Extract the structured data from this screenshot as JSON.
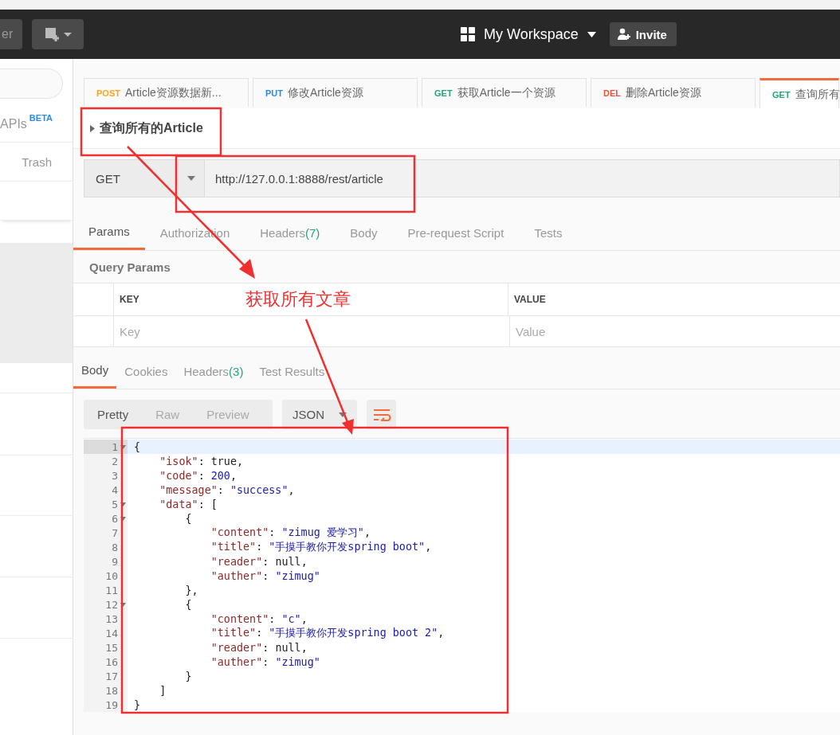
{
  "top_bar": {
    "left_button": "er",
    "workspace": "My Workspace",
    "invite_button": "Invite"
  },
  "sidebar": {
    "apis_label": "APIs",
    "apis_badge": "BETA",
    "trash_label": "Trash",
    "rows": [
      {
        "selected": false
      },
      {
        "selected": true
      },
      {
        "selected": false
      },
      {
        "selected": false
      },
      {
        "selected": false
      },
      {
        "selected": false
      },
      {
        "selected": false
      }
    ]
  },
  "tabs": [
    {
      "method": "POST",
      "color": "#f5a623",
      "label": "Article资源数据新...",
      "selected": false
    },
    {
      "method": "PUT",
      "color": "#2d8ae6",
      "label": "修改Article资源",
      "selected": false
    },
    {
      "method": "GET",
      "color": "#26a37a",
      "label": "获取Article一个资源",
      "selected": false
    },
    {
      "method": "DEL",
      "color": "#e5533b",
      "label": "删除Article资源",
      "selected": false
    },
    {
      "method": "GET",
      "color": "#26a37a",
      "label": "查询所有",
      "selected": true
    }
  ],
  "request": {
    "name": "查询所有的Article",
    "method": "GET",
    "url": "http://127.0.0.1:8888/rest/article"
  },
  "request_tabs": [
    {
      "label": "Params",
      "selected": true
    },
    {
      "label": "Authorization",
      "selected": false
    },
    {
      "label": "Headers",
      "count": "(7)",
      "selected": false
    },
    {
      "label": "Body",
      "selected": false
    },
    {
      "label": "Pre-request Script",
      "selected": false
    },
    {
      "label": "Tests",
      "selected": false
    }
  ],
  "query_params": {
    "title": "Query Params",
    "columns": [
      "KEY",
      "VALUE"
    ],
    "placeholders": [
      "Key",
      "Value"
    ]
  },
  "response_tabs": [
    {
      "label": "Body",
      "selected": true
    },
    {
      "label": "Cookies",
      "selected": false
    },
    {
      "label": "Headers",
      "count": "(3)",
      "selected": false
    },
    {
      "label": "Test Results",
      "selected": false
    }
  ],
  "view_modes": [
    {
      "label": "Pretty",
      "selected": true
    },
    {
      "label": "Raw",
      "selected": false
    },
    {
      "label": "Preview",
      "selected": false
    }
  ],
  "format": "JSON",
  "code_lines": [
    {
      "number": "1",
      "foldable": true,
      "active": true,
      "tokens": [
        {
          "kind": "p",
          "text": "{"
        }
      ]
    },
    {
      "number": "2",
      "foldable": false,
      "active": false,
      "tokens": [
        {
          "kind": "key",
          "text": "    \"isok\""
        },
        {
          "kind": "p",
          "text": ": "
        },
        {
          "kind": "lit",
          "text": "true"
        },
        {
          "kind": "p",
          "text": ","
        }
      ]
    },
    {
      "number": "3",
      "foldable": false,
      "active": false,
      "tokens": [
        {
          "kind": "key",
          "text": "    \"code\""
        },
        {
          "kind": "p",
          "text": ": "
        },
        {
          "kind": "num",
          "text": "200"
        },
        {
          "kind": "p",
          "text": ","
        }
      ]
    },
    {
      "number": "4",
      "foldable": false,
      "active": false,
      "tokens": [
        {
          "kind": "key",
          "text": "    \"message\""
        },
        {
          "kind": "p",
          "text": ": "
        },
        {
          "kind": "str",
          "text": "\"success\""
        },
        {
          "kind": "p",
          "text": ","
        }
      ]
    },
    {
      "number": "5",
      "foldable": true,
      "active": false,
      "tokens": [
        {
          "kind": "key",
          "text": "    \"data\""
        },
        {
          "kind": "p",
          "text": ": ["
        }
      ]
    },
    {
      "number": "6",
      "foldable": true,
      "active": false,
      "tokens": [
        {
          "kind": "p",
          "text": "        {"
        }
      ]
    },
    {
      "number": "7",
      "foldable": false,
      "active": false,
      "tokens": [
        {
          "kind": "key",
          "text": "            \"content\""
        },
        {
          "kind": "p",
          "text": ": "
        },
        {
          "kind": "str",
          "text": "\"zimug 爱学习\""
        },
        {
          "kind": "p",
          "text": ","
        }
      ]
    },
    {
      "number": "8",
      "foldable": false,
      "active": false,
      "tokens": [
        {
          "kind": "key",
          "text": "            \"title\""
        },
        {
          "kind": "p",
          "text": ": "
        },
        {
          "kind": "str",
          "text": "\"手摸手教你开发spring boot\""
        },
        {
          "kind": "p",
          "text": ","
        }
      ]
    },
    {
      "number": "9",
      "foldable": false,
      "active": false,
      "tokens": [
        {
          "kind": "key",
          "text": "            \"reader\""
        },
        {
          "kind": "p",
          "text": ": "
        },
        {
          "kind": "lit",
          "text": "null"
        },
        {
          "kind": "p",
          "text": ","
        }
      ]
    },
    {
      "number": "10",
      "foldable": false,
      "active": false,
      "tokens": [
        {
          "kind": "key",
          "text": "            \"auther\""
        },
        {
          "kind": "p",
          "text": ": "
        },
        {
          "kind": "str",
          "text": "\"zimug\""
        }
      ]
    },
    {
      "number": "11",
      "foldable": false,
      "active": false,
      "tokens": [
        {
          "kind": "p",
          "text": "        },"
        }
      ]
    },
    {
      "number": "12",
      "foldable": true,
      "active": false,
      "tokens": [
        {
          "kind": "p",
          "text": "        {"
        }
      ]
    },
    {
      "number": "13",
      "foldable": false,
      "active": false,
      "tokens": [
        {
          "kind": "key",
          "text": "            \"content\""
        },
        {
          "kind": "p",
          "text": ": "
        },
        {
          "kind": "str",
          "text": "\"c\""
        },
        {
          "kind": "p",
          "text": ","
        }
      ]
    },
    {
      "number": "14",
      "foldable": false,
      "active": false,
      "tokens": [
        {
          "kind": "key",
          "text": "            \"title\""
        },
        {
          "kind": "p",
          "text": ": "
        },
        {
          "kind": "str",
          "text": "\"手摸手教你开发spring boot 2\""
        },
        {
          "kind": "p",
          "text": ","
        }
      ]
    },
    {
      "number": "15",
      "foldable": false,
      "active": false,
      "tokens": [
        {
          "kind": "key",
          "text": "            \"reader\""
        },
        {
          "kind": "p",
          "text": ": "
        },
        {
          "kind": "lit",
          "text": "null"
        },
        {
          "kind": "p",
          "text": ","
        }
      ]
    },
    {
      "number": "16",
      "foldable": false,
      "active": false,
      "tokens": [
        {
          "kind": "key",
          "text": "            \"auther\""
        },
        {
          "kind": "p",
          "text": ": "
        },
        {
          "kind": "str",
          "text": "\"zimug\""
        }
      ]
    },
    {
      "number": "17",
      "foldable": false,
      "active": false,
      "tokens": [
        {
          "kind": "p",
          "text": "        }"
        }
      ]
    },
    {
      "number": "18",
      "foldable": false,
      "active": false,
      "tokens": [
        {
          "kind": "p",
          "text": "    ]"
        }
      ]
    },
    {
      "number": "19",
      "foldable": false,
      "active": false,
      "tokens": [
        {
          "kind": "p",
          "text": "}"
        }
      ]
    }
  ],
  "annotation": {
    "text": "获取所有文章"
  }
}
